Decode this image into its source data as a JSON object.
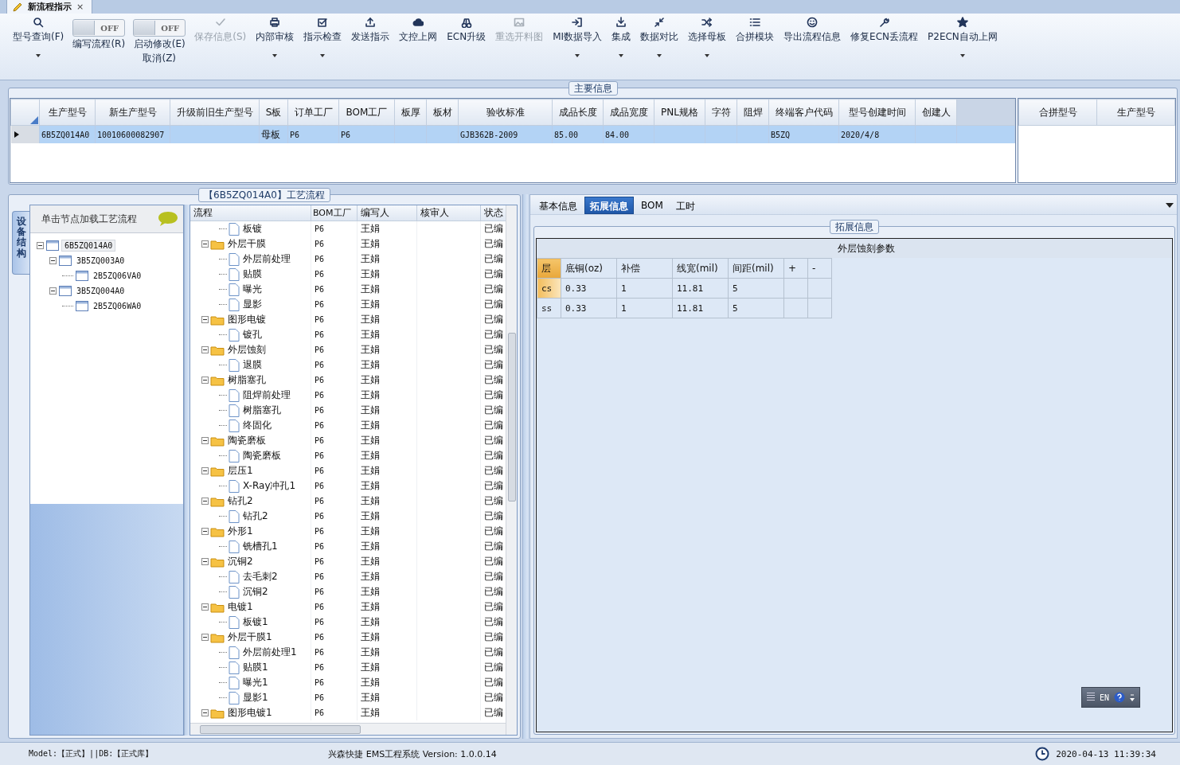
{
  "window": {
    "title": "新流程指示",
    "close": "×"
  },
  "toolbar": [
    {
      "kind": "button",
      "labels": [
        "型号查询(F)"
      ],
      "disabled": false,
      "menu": true
    },
    {
      "kind": "toggle",
      "state_text": "OFF",
      "on": false,
      "labels": [
        "编写流程(R)"
      ]
    },
    {
      "kind": "toggle",
      "state_text": "OFF",
      "on": false,
      "labels": [
        "启动修改(E)",
        "取消(Z)"
      ]
    },
    {
      "kind": "button",
      "labels": [
        "保存信息(S)"
      ],
      "disabled": true,
      "menu": false
    },
    {
      "kind": "button",
      "labels": [
        "内部审核"
      ],
      "disabled": false,
      "menu": true
    },
    {
      "kind": "button",
      "labels": [
        "指示检查"
      ],
      "disabled": false,
      "menu": true
    },
    {
      "kind": "button",
      "labels": [
        "发送指示"
      ],
      "disabled": false,
      "menu": false
    },
    {
      "kind": "button",
      "labels": [
        "文控上网"
      ],
      "disabled": false,
      "menu": false
    },
    {
      "kind": "button",
      "labels": [
        "ECN升级"
      ],
      "disabled": false,
      "menu": false
    },
    {
      "kind": "button",
      "labels": [
        "重选开料图"
      ],
      "disabled": true,
      "menu": false
    },
    {
      "kind": "button",
      "labels": [
        "MI数据导入"
      ],
      "disabled": false,
      "menu": true
    },
    {
      "kind": "button",
      "labels": [
        "集成"
      ],
      "disabled": false,
      "menu": true
    },
    {
      "kind": "button",
      "labels": [
        "数据对比"
      ],
      "disabled": false,
      "menu": true
    },
    {
      "kind": "button",
      "labels": [
        "选择母板"
      ],
      "disabled": false,
      "menu": true
    },
    {
      "kind": "button",
      "labels": [
        "合拼模块"
      ],
      "disabled": false,
      "menu": false
    },
    {
      "kind": "button",
      "labels": [
        "导出流程信息"
      ],
      "disabled": false,
      "menu": false
    },
    {
      "kind": "button",
      "labels": [
        "修复ECN丢流程"
      ],
      "disabled": false,
      "menu": false
    },
    {
      "kind": "button",
      "labels": [
        "P2ECN自动上网"
      ],
      "disabled": false,
      "menu": true
    }
  ],
  "main_info": {
    "caption": "主要信息",
    "columns": [
      "生产型号",
      "新生产型号",
      "升级前旧生产型号",
      "S板",
      "订单工厂",
      "BOM工厂",
      "板厚",
      "板材",
      "验收标准",
      "成品长度",
      "成品宽度",
      "PNL规格",
      "字符",
      "阻焊",
      "终端客户代码",
      "型号创建时间",
      "创建人"
    ],
    "rows": [
      {
        "selected": true,
        "cells": [
          "6B5ZQ014A0",
          "10010600082907",
          "",
          "母板",
          "P6",
          "P6",
          "",
          "",
          "GJB362B-2009",
          "85.00",
          "84.00",
          "",
          "",
          "",
          "B5ZQ",
          "2020/4/8",
          ""
        ]
      }
    ],
    "side_columns": [
      "合拼型号",
      "生产型号"
    ]
  },
  "process": {
    "caption": "【6B5ZQ014A0】工艺流程",
    "side_tab": "设备结构",
    "hint": "单击节点加载工艺流程",
    "device_tree": [
      {
        "label": "6B5ZQ014A0",
        "selected": true,
        "expanded": true,
        "children": [
          {
            "label": "3B5ZQ003A0",
            "selected": false,
            "expanded": true,
            "children": [
              {
                "label": "2B5ZQ06VA0",
                "selected": false
              }
            ]
          },
          {
            "label": "3B5ZQ004A0",
            "selected": false,
            "expanded": true,
            "children": [
              {
                "label": "2B5ZQ06WA0",
                "selected": false
              }
            ]
          }
        ]
      }
    ],
    "columns": [
      "流程",
      "BOM工厂",
      "编写人",
      "核审人",
      "状态"
    ],
    "rows": [
      {
        "kind": "step",
        "name": "板镀",
        "bom": "P6",
        "writer": "王娟",
        "status": "已编"
      },
      {
        "kind": "folder",
        "name": "外层干膜",
        "bom": "P6",
        "writer": "王娟",
        "status": "已编",
        "expanded": true,
        "children": [
          {
            "kind": "step",
            "name": "外层前处理",
            "bom": "P6",
            "writer": "王娟",
            "status": "已编"
          },
          {
            "kind": "step",
            "name": "贴膜",
            "bom": "P6",
            "writer": "王娟",
            "status": "已编"
          },
          {
            "kind": "step",
            "name": "曝光",
            "bom": "P6",
            "writer": "王娟",
            "status": "已编"
          },
          {
            "kind": "step",
            "name": "显影",
            "bom": "P6",
            "writer": "王娟",
            "status": "已编"
          }
        ]
      },
      {
        "kind": "folder",
        "name": "图形电镀",
        "bom": "P6",
        "writer": "王娟",
        "status": "已编",
        "expanded": true,
        "children": [
          {
            "kind": "step",
            "name": "镀孔",
            "bom": "P6",
            "writer": "王娟",
            "status": "已编"
          }
        ]
      },
      {
        "kind": "folder",
        "name": "外层蚀刻",
        "bom": "P6",
        "writer": "王娟",
        "status": "已编",
        "expanded": true,
        "children": [
          {
            "kind": "step",
            "name": "退膜",
            "bom": "P6",
            "writer": "王娟",
            "status": "已编"
          }
        ]
      },
      {
        "kind": "folder",
        "name": "树脂塞孔",
        "bom": "P6",
        "writer": "王娟",
        "status": "已编",
        "expanded": true,
        "children": [
          {
            "kind": "step",
            "name": "阻焊前处理",
            "bom": "P6",
            "writer": "王娟",
            "status": "已编"
          },
          {
            "kind": "step",
            "name": "树脂塞孔",
            "bom": "P6",
            "writer": "王娟",
            "status": "已编"
          },
          {
            "kind": "step",
            "name": "终固化",
            "bom": "P6",
            "writer": "王娟",
            "status": "已编"
          }
        ]
      },
      {
        "kind": "folder",
        "name": "陶瓷磨板",
        "bom": "P6",
        "writer": "王娟",
        "status": "已编",
        "expanded": true,
        "children": [
          {
            "kind": "step",
            "name": "陶瓷磨板",
            "bom": "P6",
            "writer": "王娟",
            "status": "已编"
          }
        ]
      },
      {
        "kind": "folder",
        "name": "层压1",
        "bom": "P6",
        "writer": "王娟",
        "status": "已编",
        "expanded": true,
        "children": [
          {
            "kind": "step",
            "name": "X-Ray冲孔1",
            "bom": "P6",
            "writer": "王娟",
            "status": "已编"
          }
        ]
      },
      {
        "kind": "folder",
        "name": "钻孔2",
        "bom": "P6",
        "writer": "王娟",
        "status": "已编",
        "expanded": true,
        "children": [
          {
            "kind": "step",
            "name": "钻孔2",
            "bom": "P6",
            "writer": "王娟",
            "status": "已编"
          }
        ]
      },
      {
        "kind": "folder",
        "name": "外形1",
        "bom": "P6",
        "writer": "王娟",
        "status": "已编",
        "expanded": true,
        "children": [
          {
            "kind": "step",
            "name": "铣槽孔1",
            "bom": "P6",
            "writer": "王娟",
            "status": "已编"
          }
        ]
      },
      {
        "kind": "folder",
        "name": "沉铜2",
        "bom": "P6",
        "writer": "王娟",
        "status": "已编",
        "expanded": true,
        "children": [
          {
            "kind": "step",
            "name": "去毛刺2",
            "bom": "P6",
            "writer": "王娟",
            "status": "已编"
          },
          {
            "kind": "step",
            "name": "沉铜2",
            "bom": "P6",
            "writer": "王娟",
            "status": "已编"
          }
        ]
      },
      {
        "kind": "folder",
        "name": "电镀1",
        "bom": "P6",
        "writer": "王娟",
        "status": "已编",
        "expanded": true,
        "children": [
          {
            "kind": "step",
            "name": "板镀1",
            "bom": "P6",
            "writer": "王娟",
            "status": "已编"
          }
        ]
      },
      {
        "kind": "folder",
        "name": "外层干膜1",
        "bom": "P6",
        "writer": "王娟",
        "status": "已编",
        "expanded": true,
        "children": [
          {
            "kind": "step",
            "name": "外层前处理1",
            "bom": "P6",
            "writer": "王娟",
            "status": "已编"
          },
          {
            "kind": "step",
            "name": "贴膜1",
            "bom": "P6",
            "writer": "王娟",
            "status": "已编"
          },
          {
            "kind": "step",
            "name": "曝光1",
            "bom": "P6",
            "writer": "王娟",
            "status": "已编"
          },
          {
            "kind": "step",
            "name": "显影1",
            "bom": "P6",
            "writer": "王娟",
            "status": "已编"
          }
        ]
      },
      {
        "kind": "folder",
        "name": "图形电镀1",
        "bom": "P6",
        "writer": "王娟",
        "status": "已编",
        "expanded": true
      }
    ]
  },
  "detail": {
    "tabs": [
      {
        "label": "基本信息",
        "selected": false
      },
      {
        "label": "拓展信息",
        "selected": true
      },
      {
        "label": "BOM",
        "selected": false
      },
      {
        "label": "工时",
        "selected": false
      }
    ],
    "caption": "拓展信息",
    "grid_title": "外层蚀刻参数",
    "columns": [
      "层",
      "底铜(oz)",
      "补偿",
      "线宽(mil)",
      "间距(mil)",
      "+",
      "-"
    ],
    "rows": [
      {
        "selected": true,
        "cells": [
          "cs",
          "0.33",
          "1",
          "11.81",
          "5",
          "",
          ""
        ]
      },
      {
        "selected": false,
        "cells": [
          "ss",
          "0.33",
          "1",
          "11.81",
          "5",
          "",
          ""
        ]
      }
    ],
    "language": "EN"
  },
  "status_bar": {
    "model": "Model:【正式】||DB:【正式库】",
    "product": "兴森快捷 EMS工程系统 Version: 1.0.0.14",
    "time": "2020-04-13 11:39:34"
  }
}
